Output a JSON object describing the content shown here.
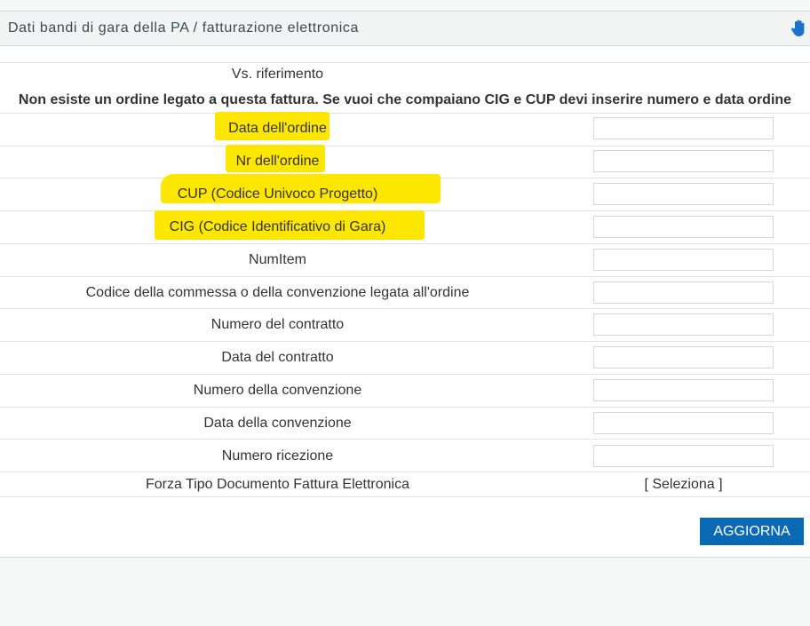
{
  "header": {
    "title": "Dati bandi di gara della PA / fatturazione elettronica"
  },
  "rows": {
    "vs_riferimento": "Vs. riferimento",
    "notice": "Non esiste un ordine legato a questa fattura. Se vuoi che compaiano CIG e CUP devi inserire numero e data ordine",
    "data_ordine": "Data dell'ordine",
    "nr_ordine": "Nr dell'ordine",
    "cup": "CUP (Codice Univoco Progetto)",
    "cig": "CIG (Codice Identificativo di Gara)",
    "num_item": "NumItem",
    "codice_commessa": "Codice della commessa o della convenzione legata all'ordine",
    "numero_contratto": "Numero del contratto",
    "data_contratto": "Data del contratto",
    "numero_convenzione": "Numero della convenzione",
    "data_convenzione": "Data della convenzione",
    "numero_ricezione": "Numero ricezione",
    "forza_tipo": "Forza Tipo Documento Fattura Elettronica"
  },
  "fields": {
    "data_ordine_value": "",
    "cig_value": ""
  },
  "actions": {
    "seleziona": "[ Seleziona ]",
    "aggiorna": "AGGIORNA"
  },
  "colors": {
    "highlight": "#fde700",
    "button": "#0a69b5",
    "hand_icon": "#1a73c8"
  }
}
